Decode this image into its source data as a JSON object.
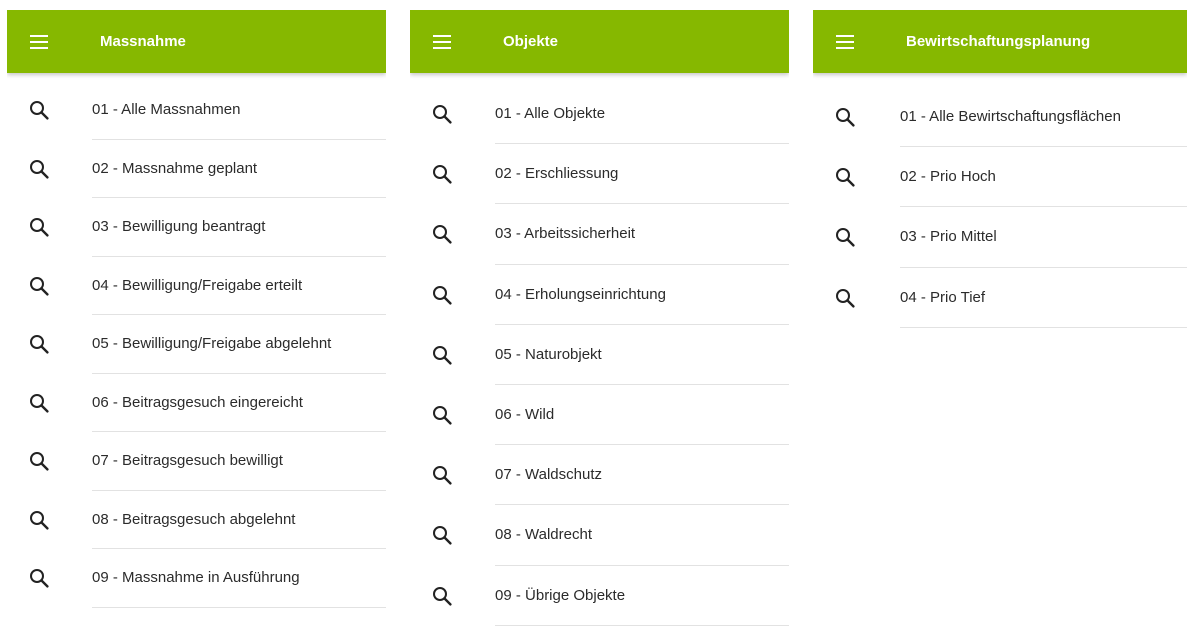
{
  "panels": [
    {
      "title": "Massnahme",
      "items": [
        "01 - Alle Massnahmen",
        "02 - Massnahme geplant",
        "03 - Bewilligung beantragt",
        "04 - Bewilligung/Freigabe erteilt",
        "05 - Bewilligung/Freigabe abgelehnt",
        "06 - Beitragsgesuch eingereicht",
        "07 - Beitragsgesuch bewilligt",
        "08 - Beitragsgesuch abgelehnt",
        "09 - Massnahme in Ausführung"
      ]
    },
    {
      "title": "Objekte",
      "items": [
        "01 - Alle Objekte",
        "02 - Erschliessung",
        "03 - Arbeitssicherheit",
        "04 - Erholungseinrichtung",
        "05 - Naturobjekt",
        "06 - Wild",
        "07 - Waldschutz",
        "08 - Waldrecht",
        "09 - Übrige Objekte"
      ]
    },
    {
      "title": "Bewirtschaftungsplanung",
      "items": [
        "01 - Alle Bewirtschaftungsflächen",
        "02 - Prio Hoch",
        "03 - Prio Mittel",
        "04 - Prio Tief"
      ]
    }
  ],
  "icons": {
    "menu": "hamburger-menu-icon",
    "item": "search-icon"
  },
  "colors": {
    "header": "#86b800",
    "header_text": "#ffffff",
    "item_text": "#2b2b2b",
    "divider": "#e2e2e2"
  }
}
